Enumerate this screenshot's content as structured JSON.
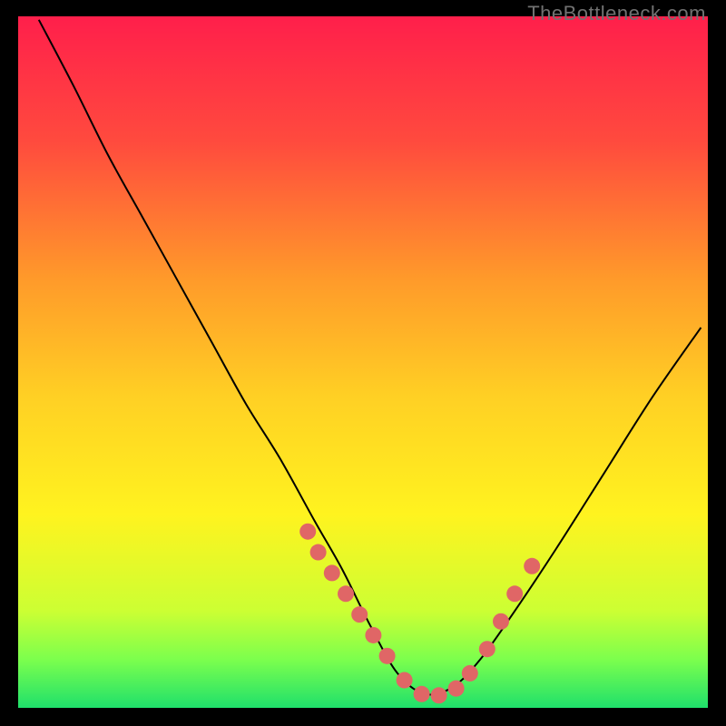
{
  "watermark": "TheBottleneck.com",
  "chart_data": {
    "type": "line",
    "title": "",
    "xlabel": "",
    "ylabel": "",
    "xlim": [
      0,
      1
    ],
    "ylim": [
      0,
      1
    ],
    "note": "Axes are unlabeled; values are normalized to the plot area. Curve is a V-shaped bottleneck profile with minimum near x≈0.56.",
    "series": [
      {
        "name": "curve",
        "x": [
          0.03,
          0.08,
          0.13,
          0.18,
          0.23,
          0.28,
          0.33,
          0.38,
          0.43,
          0.47,
          0.51,
          0.55,
          0.59,
          0.63,
          0.67,
          0.72,
          0.78,
          0.85,
          0.92,
          0.99
        ],
        "y": [
          0.995,
          0.9,
          0.8,
          0.71,
          0.62,
          0.53,
          0.44,
          0.36,
          0.27,
          0.2,
          0.12,
          0.05,
          0.02,
          0.03,
          0.07,
          0.14,
          0.23,
          0.34,
          0.45,
          0.55
        ]
      }
    ],
    "markers": {
      "name": "highlighted-points",
      "x": [
        0.42,
        0.435,
        0.455,
        0.475,
        0.495,
        0.515,
        0.535,
        0.56,
        0.585,
        0.61,
        0.635,
        0.655,
        0.68,
        0.7,
        0.72,
        0.745
      ],
      "y": [
        0.255,
        0.225,
        0.195,
        0.165,
        0.135,
        0.105,
        0.075,
        0.04,
        0.02,
        0.018,
        0.028,
        0.05,
        0.085,
        0.125,
        0.165,
        0.205
      ]
    },
    "gradient_stops": [
      {
        "offset": 0.0,
        "color": "#ff1f4b"
      },
      {
        "offset": 0.18,
        "color": "#ff4a3e"
      },
      {
        "offset": 0.38,
        "color": "#ff9a2a"
      },
      {
        "offset": 0.55,
        "color": "#ffd024"
      },
      {
        "offset": 0.72,
        "color": "#fff31f"
      },
      {
        "offset": 0.86,
        "color": "#ccff33"
      },
      {
        "offset": 0.93,
        "color": "#7cff4d"
      },
      {
        "offset": 1.0,
        "color": "#1fe06b"
      }
    ],
    "marker_color": "#e06666",
    "curve_color": "#000000"
  }
}
